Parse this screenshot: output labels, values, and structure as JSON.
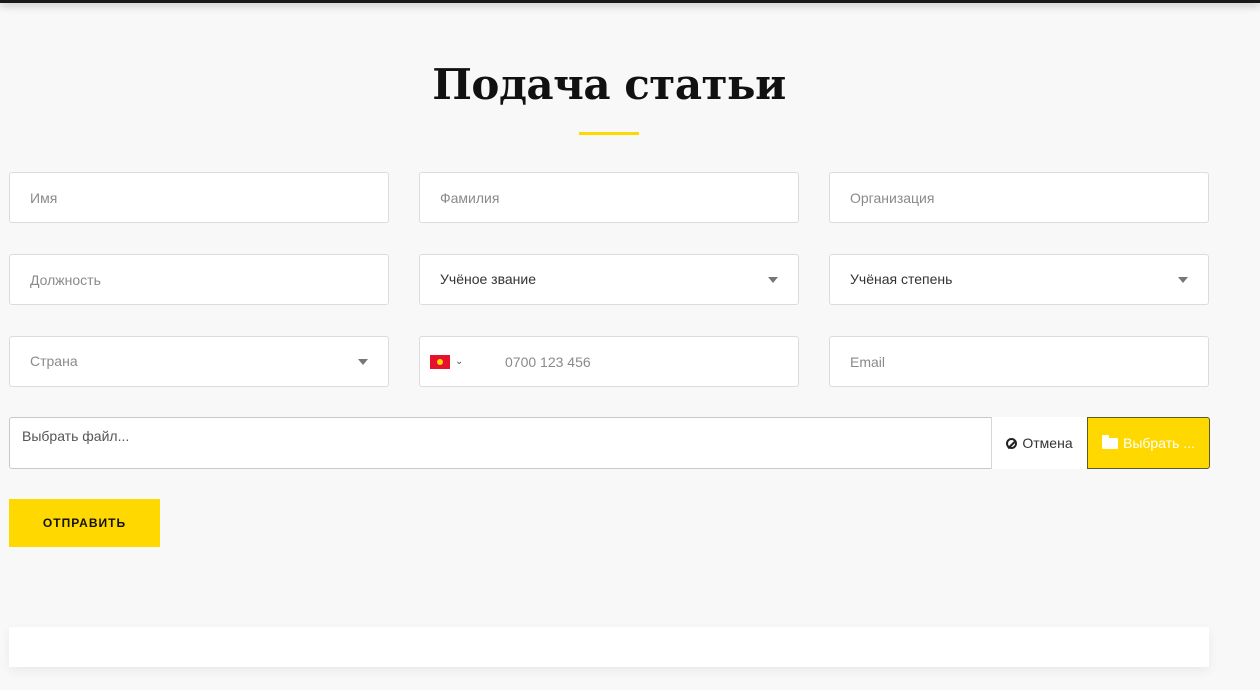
{
  "page": {
    "title": "Подача статьи"
  },
  "colors": {
    "accent": "#ffd800",
    "background": "#f8f8f9",
    "text": "#111111"
  },
  "form": {
    "first_name": {
      "placeholder": "Имя",
      "value": ""
    },
    "last_name": {
      "placeholder": "Фамилия",
      "value": ""
    },
    "organization": {
      "placeholder": "Организация",
      "value": ""
    },
    "position": {
      "placeholder": "Должность",
      "value": ""
    },
    "academic_title": {
      "selected": "Учёное звание"
    },
    "academic_degree": {
      "selected": "Учёная степень"
    },
    "country": {
      "selected": "Страна"
    },
    "phone": {
      "placeholder": "0700 123 456",
      "value": "",
      "flag": "kyrgyzstan-flag-icon"
    },
    "email": {
      "placeholder": "Email",
      "value": ""
    },
    "file": {
      "caption": "Выбрать файл...",
      "cancel_label": "Отмена",
      "cancel_icon": "ban-icon",
      "browse_label": "Выбрать ...",
      "browse_icon": "folder-open-icon"
    },
    "submit_label": "ОТПРАВИТЬ"
  }
}
